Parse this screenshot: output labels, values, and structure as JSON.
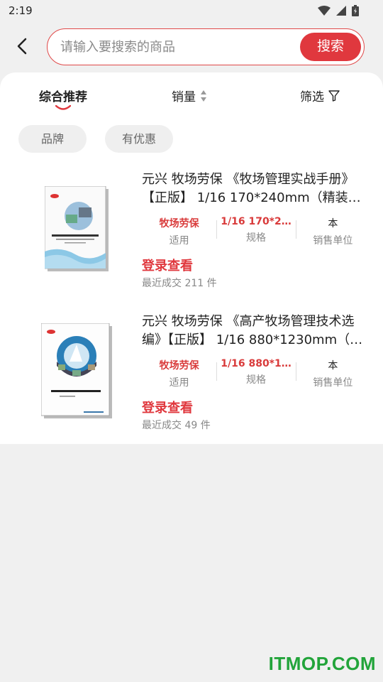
{
  "status": {
    "time": "2:19"
  },
  "search": {
    "placeholder": "请输入要搜索的商品",
    "button_label": "搜索"
  },
  "sort": {
    "comprehensive": "综合推荐",
    "sales": "销量",
    "filter": "筛选"
  },
  "chips": [
    "品牌",
    "有优惠"
  ],
  "products": [
    {
      "title_line1": "元兴 牧场劳保 《牧场管理实战手册》",
      "title_line2": "【正版】 1/16 170*240mm（精装…",
      "attrs": [
        {
          "value": "牧场劳保",
          "label": "适用"
        },
        {
          "value": "1/16 170*2…",
          "label": "规格"
        },
        {
          "value": "本",
          "label": "销售单位"
        }
      ],
      "login": "登录查看",
      "recent": "最近成交 211 件",
      "cover_title": "牧场管理实战手册"
    },
    {
      "title_line1": "元兴 牧场劳保 《高产牧场管理技术选",
      "title_line2": "编》【正版】 1/16 880*1230mm（…",
      "attrs": [
        {
          "value": "牧场劳保",
          "label": "适用"
        },
        {
          "value": "1/16 880*1…",
          "label": "规格"
        },
        {
          "value": "本",
          "label": "销售单位"
        }
      ],
      "login": "登录查看",
      "recent": "最近成交 49 件",
      "cover_title": "高产牧场管理技术选编"
    }
  ],
  "watermark": "ITMOP.COM",
  "colors": {
    "accent": "#e0383e",
    "watermark": "#22a43a"
  }
}
